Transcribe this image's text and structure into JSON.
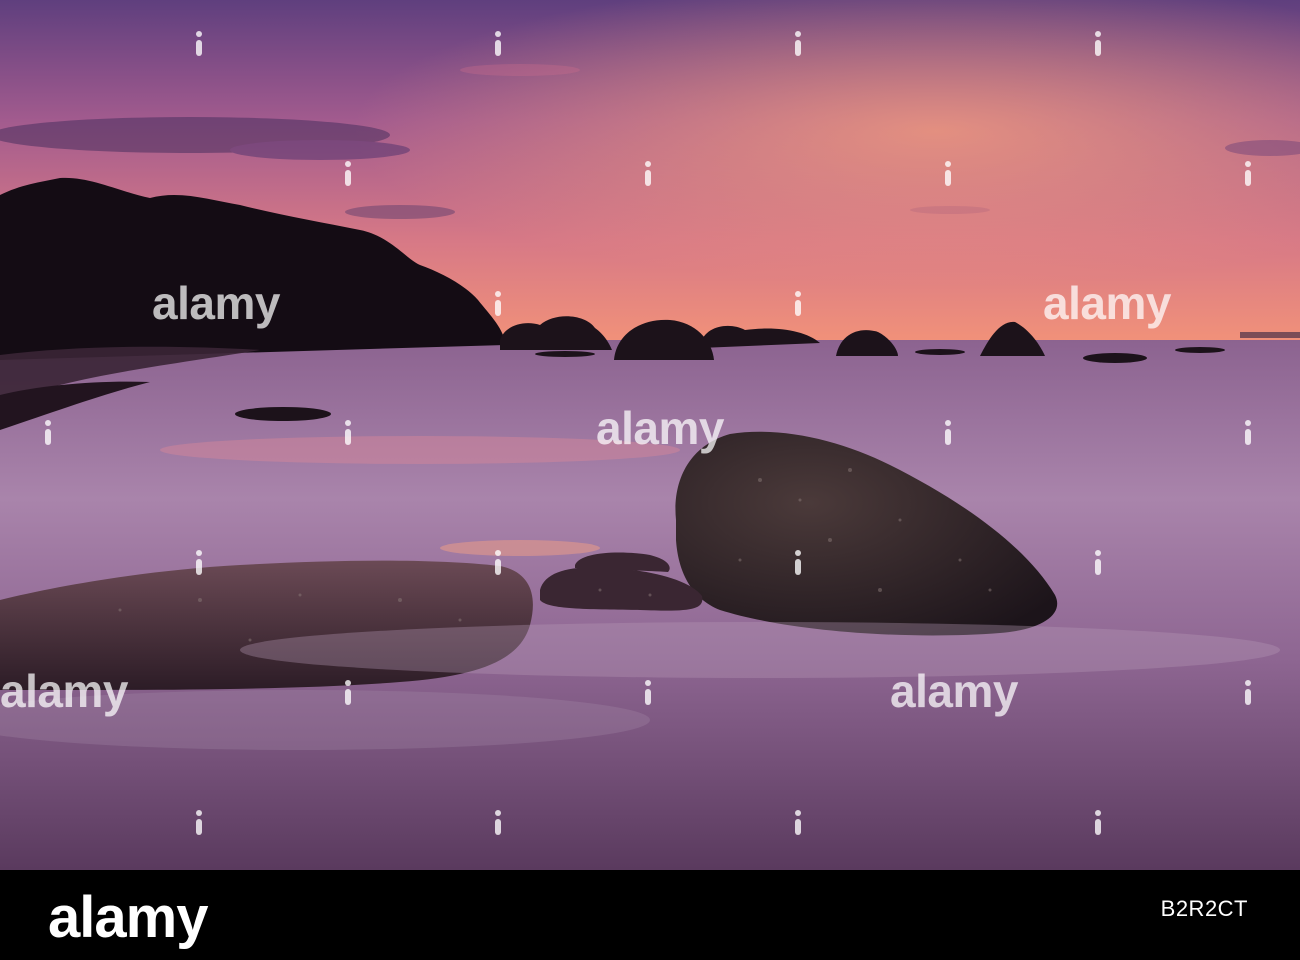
{
  "watermark": {
    "text": "alamy"
  },
  "footer": {
    "logo": "alamy",
    "image_id": "B2R2CT"
  },
  "colors": {
    "sky_top": "#6e4a86",
    "sky_mid": "#c86a8a",
    "horizon_glow": "#f08a78",
    "water": "#9a6a9c",
    "rock_dark": "#1e141e",
    "footer_bg": "#000000"
  }
}
